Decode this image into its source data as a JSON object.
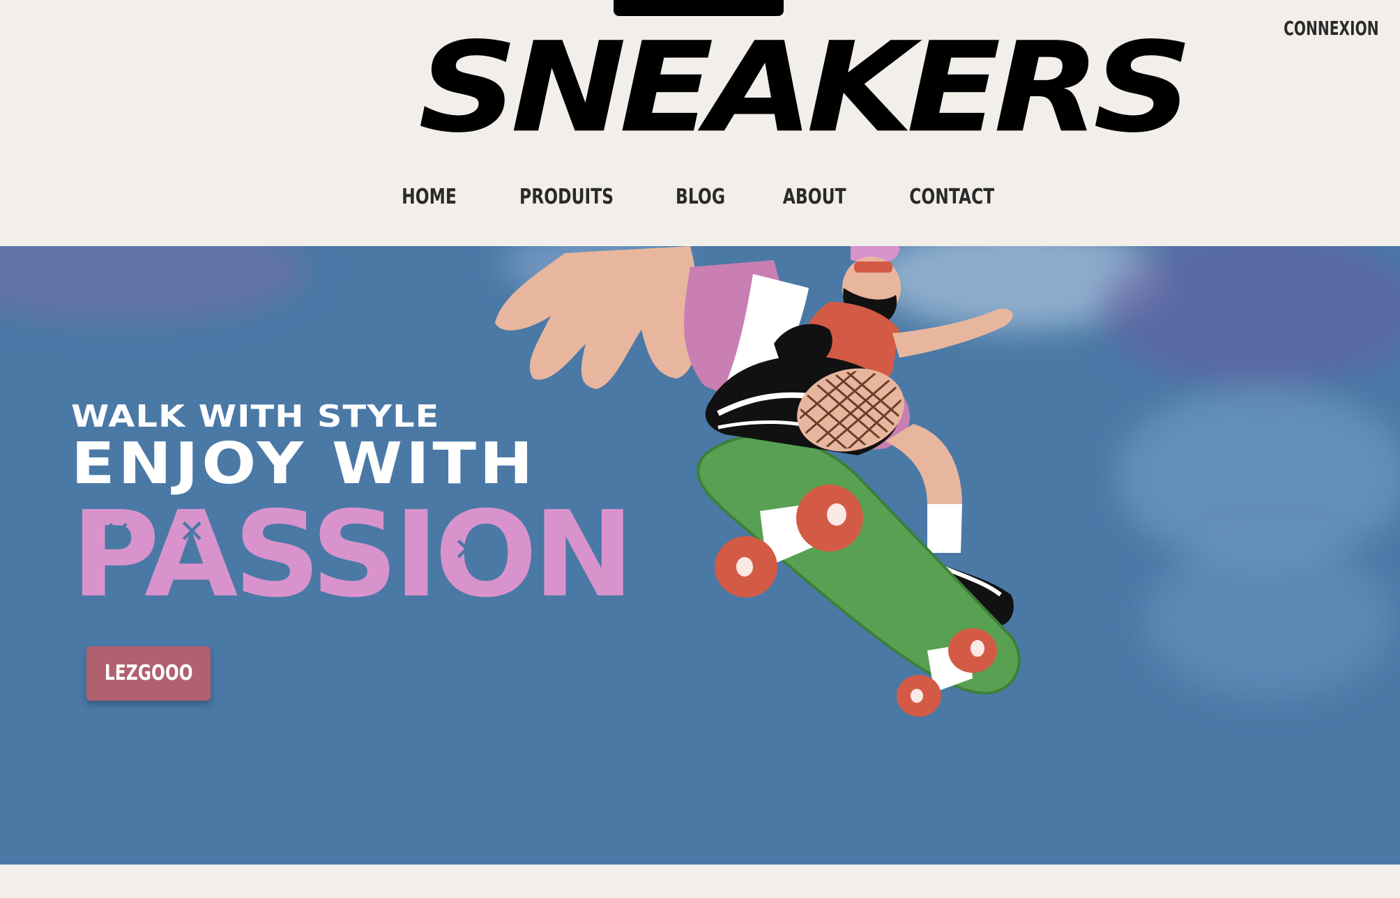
{
  "header": {
    "logo_text": "SNEAKERS",
    "login_label": "CONNEXION",
    "nav": [
      {
        "label": "HOME"
      },
      {
        "label": "PRODUITS"
      },
      {
        "label": "BLOG"
      },
      {
        "label": "ABOUT"
      },
      {
        "label": "CONTACT"
      }
    ]
  },
  "hero": {
    "tagline": "WALK WITH STYLE",
    "headline": "ENJOY WITH",
    "highlight": "PASSION",
    "cta_label": "LEZGOOO"
  },
  "colors": {
    "background": "#f2efea",
    "hero_blue": "#4a79a6",
    "passion_pink": "#d993cc",
    "cta": "#b0606e",
    "skateboard_green": "#58a152",
    "wheels": "#d35b45"
  },
  "icons": {
    "illustration": "skateboarder-illustration"
  }
}
